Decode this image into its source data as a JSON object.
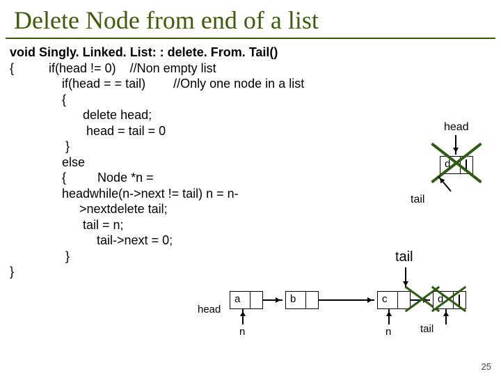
{
  "title": "Delete Node from end of a list",
  "code": {
    "sig": "void Singly. Linked. List: : delete. From. Tail()",
    "l1a": "{          if(head != 0)    //Non empty list",
    "l2": "               if(head = = tail)        //Only one node in a list",
    "l3": "               {",
    "l4": "                     delete head;",
    "l5": "                      head = tail = 0",
    "l6": "                }",
    "l7": "               else",
    "l8a": "               {         Node *n =",
    "l8b": "               headwhile(n->next != tail) n = n-",
    "l9": "                    >nextdelete tail;",
    "l10": "                     tail = n;",
    "l11": "                         tail->next = 0;",
    "l12": "                }",
    "l13": "}"
  },
  "diag1": {
    "head": "head",
    "tail": "tail",
    "node_val": "d"
  },
  "diag2": {
    "head": "head",
    "n1": "n",
    "n2": "n",
    "tail_upper": "tail",
    "tail_lower": "tail",
    "vals": {
      "a": "a",
      "b": "b",
      "c": "c",
      "d": "d"
    }
  },
  "page": "25"
}
